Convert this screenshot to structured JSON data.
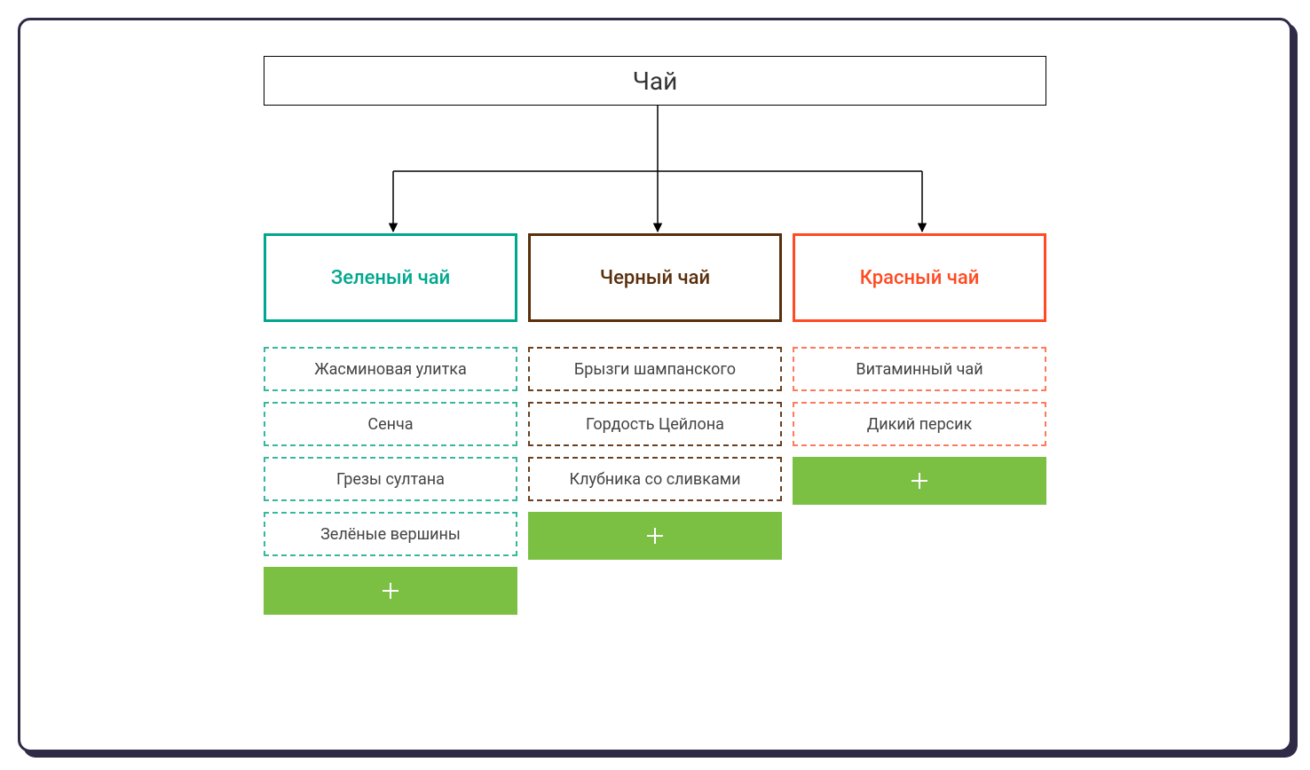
{
  "root": {
    "label": "Чай"
  },
  "colors": {
    "frame": "#2f2b47",
    "add_button_bg": "#7bc043",
    "green": "#00a78e",
    "black": "#5a2f0c",
    "red": "#ff4a22"
  },
  "categories": [
    {
      "key": "green",
      "label": "Зеленый чай",
      "items": [
        "Жасминовая улитка",
        "Сенча",
        "Грезы султана",
        "Зелёные вершины"
      ]
    },
    {
      "key": "black",
      "label": "Черный чай",
      "items": [
        "Брызги шампанского",
        "Гордость Цейлона",
        "Клубника со сливками"
      ]
    },
    {
      "key": "red",
      "label": "Красный чай",
      "items": [
        "Витаминный чай",
        "Дикий персик"
      ]
    }
  ]
}
